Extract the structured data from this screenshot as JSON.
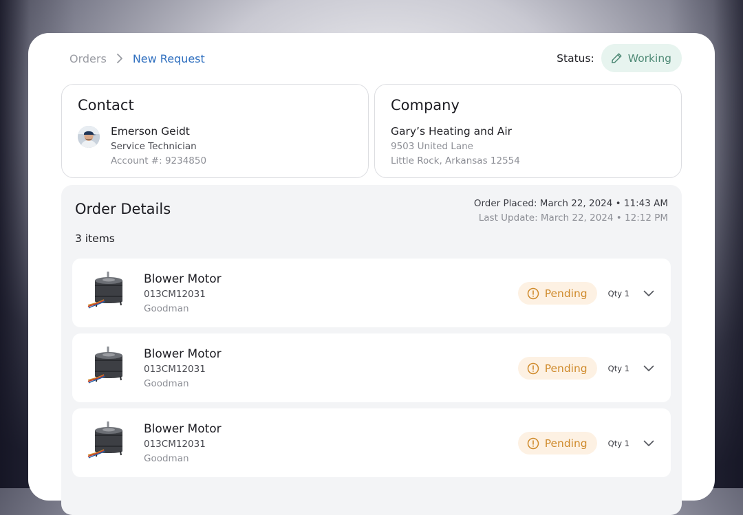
{
  "breadcrumb": {
    "parent": "Orders",
    "current": "New Request"
  },
  "status": {
    "label": "Status:",
    "value": "Working",
    "icon": "pencil-icon",
    "color": "#4f8a76",
    "background": "#e7f4ef"
  },
  "contact": {
    "title": "Contact",
    "name": "Emerson Geidt",
    "role": "Service Technician",
    "account": "Account #: 9234850"
  },
  "company": {
    "title": "Company",
    "name": "Gary’s Heating and Air",
    "address_line1": "9503 United Lane",
    "address_line2": "Little Rock, Arkansas 12554"
  },
  "order": {
    "title": "Order Details",
    "placed": "Order Placed: March 22, 2024 • 11:43 AM",
    "updated": "Last Update: March 22, 2024 • 12:12 PM",
    "item_count": "3 items",
    "items": [
      {
        "name": "Blower Motor",
        "part_number": "013CM12031",
        "brand": "Goodman",
        "status": "Pending",
        "qty": "Qty 1"
      },
      {
        "name": "Blower Motor",
        "part_number": "013CM12031",
        "brand": "Goodman",
        "status": "Pending",
        "qty": "Qty 1"
      },
      {
        "name": "Blower Motor",
        "part_number": "013CM12031",
        "brand": "Goodman",
        "status": "Pending",
        "qty": "Qty 1"
      }
    ]
  },
  "colors": {
    "accent": "#2f6fbf",
    "pending": "#cf8a2b",
    "pending_background": "#fdf1e3"
  }
}
